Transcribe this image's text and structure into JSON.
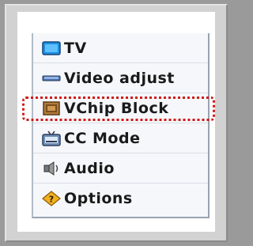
{
  "menu": {
    "items": [
      {
        "label": "TV",
        "icon": "tv-icon"
      },
      {
        "label": "Video adjust",
        "icon": "video-adjust-icon"
      },
      {
        "label": "VChip Block",
        "icon": "vchip-block-icon"
      },
      {
        "label": "CC Mode",
        "icon": "cc-mode-icon"
      },
      {
        "label": "Audio",
        "icon": "audio-icon"
      },
      {
        "label": "Options",
        "icon": "options-icon"
      }
    ]
  },
  "highlight": {
    "target": "VChip Block",
    "color": "#d01a1a",
    "style": "dotted"
  },
  "colors": {
    "background": "#9a9a9a",
    "frame": "#d2d2d2",
    "menu": "#f5f7fa",
    "tv_icon": "#1e8fe0"
  }
}
